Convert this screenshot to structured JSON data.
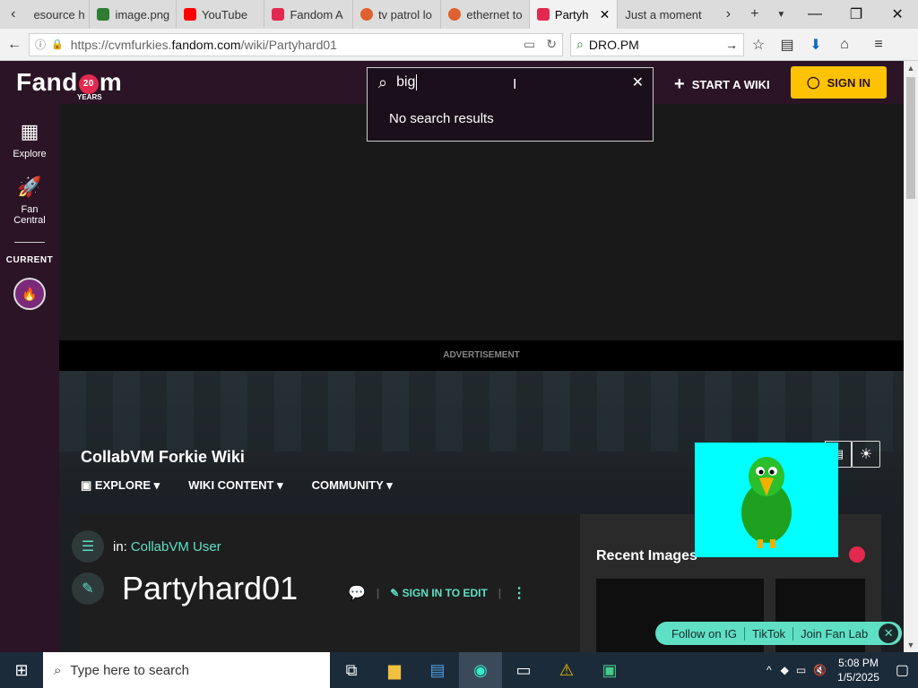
{
  "browser": {
    "tabs": [
      {
        "label": "esource h",
        "color": "#888888"
      },
      {
        "label": "image.png",
        "color": "#2e7d32"
      },
      {
        "label": "YouTube",
        "color": "#ff0000"
      },
      {
        "label": "Fandom A",
        "color": "#e3294f"
      },
      {
        "label": "tv patrol lo",
        "color": "#e06030"
      },
      {
        "label": "ethernet to",
        "color": "#e06030"
      },
      {
        "label": "Partyh",
        "color": "#e3294f"
      },
      {
        "label": "Just a moment",
        "color": "#888888"
      }
    ],
    "url_prefix": "https://cvmfurkies.",
    "url_domain": "fandom.com",
    "url_path": "/wiki/Partyhard01",
    "search_engine_text": "DRO.PM"
  },
  "site": {
    "logo_text": "Fandom",
    "logo_badge": "20",
    "logo_years": "YEARS",
    "search_value": "big",
    "search_no_results": "No search results",
    "start_wiki": "START A WIKI",
    "sign_in": "SIGN IN"
  },
  "leftnav": {
    "explore": "Explore",
    "fan_central_line1": "Fan",
    "fan_central_line2": "Central",
    "current": "CURRENT"
  },
  "advertisement": "ADVERTISEMENT",
  "wiki": {
    "name": "CollabVM Forkie Wiki",
    "nav": [
      "EXPLORE",
      "WIKI CONTENT",
      "COMMUNITY"
    ],
    "in_label": "in:",
    "category": "CollabVM User",
    "page_title": "Partyhard01",
    "sign_in_to_edit": "SIGN IN TO EDIT",
    "recent_images": "Recent Images"
  },
  "social": {
    "follow_ig": "Follow on IG",
    "tiktok": "TikTok",
    "fan_lab": "Join Fan Lab"
  },
  "taskbar": {
    "search_placeholder": "Type here to search",
    "time": "5:08 PM",
    "date": "1/5/2025"
  }
}
